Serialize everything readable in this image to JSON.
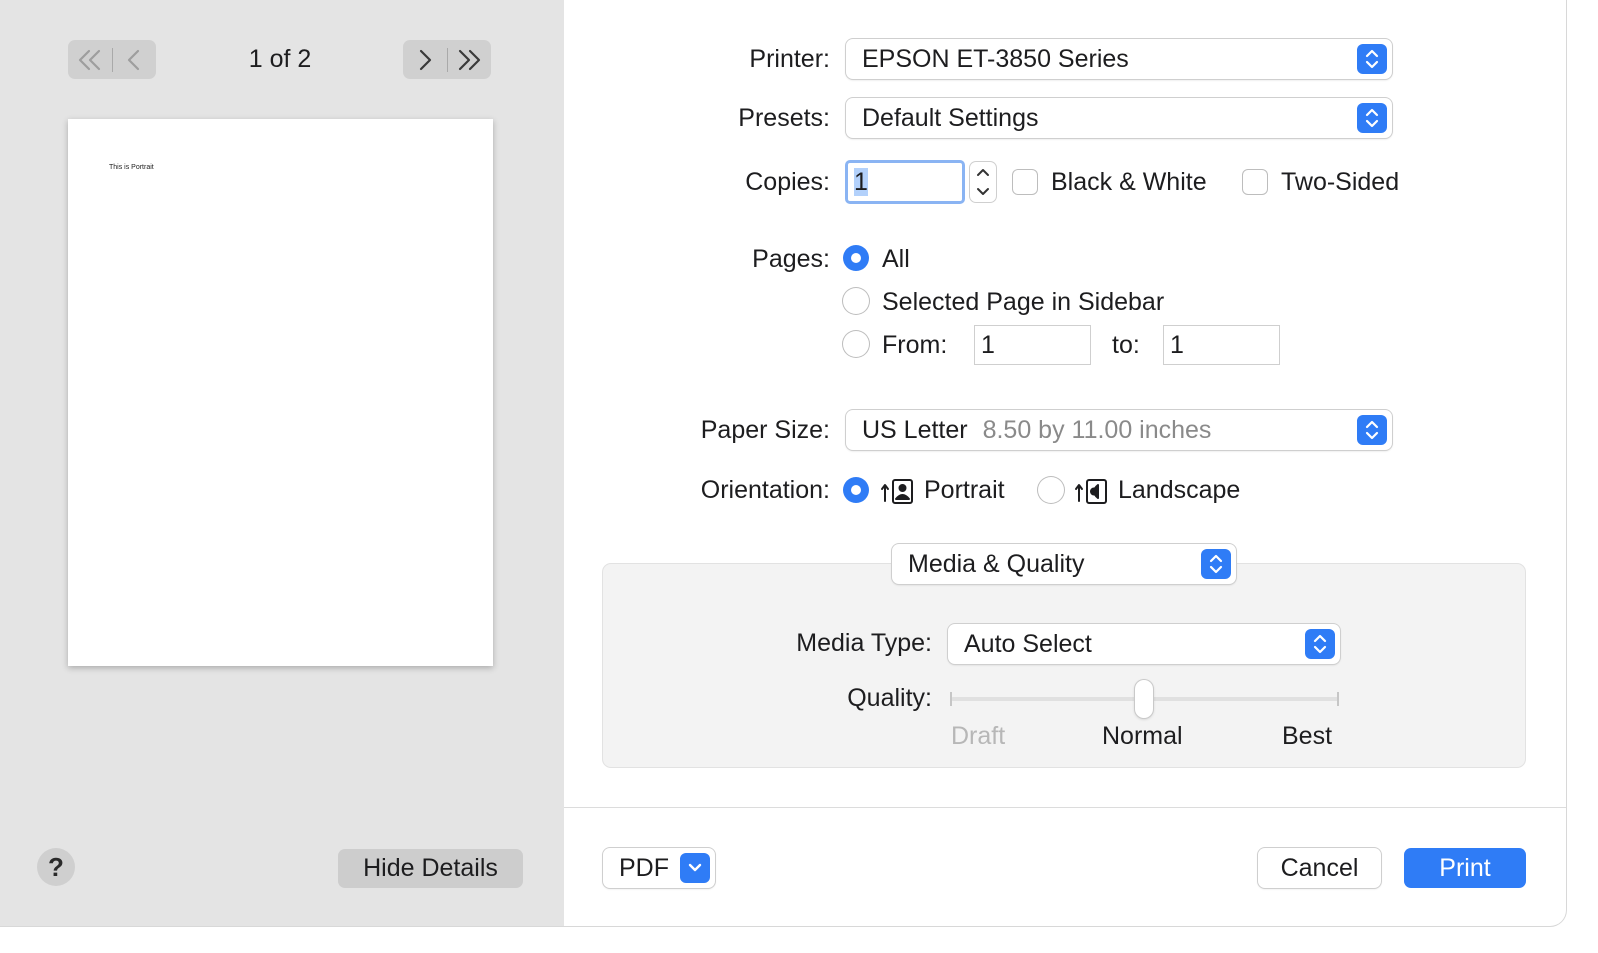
{
  "preview": {
    "page_indicator": "1 of 2",
    "page_text": "This is Portrait",
    "hide_details_label": "Hide Details",
    "help_label": "?"
  },
  "settings": {
    "printer_label": "Printer:",
    "printer_value": "EPSON ET-3850 Series",
    "presets_label": "Presets:",
    "presets_value": "Default Settings",
    "copies_label": "Copies:",
    "copies_value": "1",
    "bw_label": "Black & White",
    "two_sided_label": "Two-Sided",
    "pages_label": "Pages:",
    "pages_all": "All",
    "pages_selected": "Selected Page in Sidebar",
    "pages_from_label": "From:",
    "pages_from_value": "1",
    "pages_to_label": "to:",
    "pages_to_value": "1",
    "paper_size_label": "Paper Size:",
    "paper_size_value": "US Letter",
    "paper_size_detail": "8.50 by 11.00 inches",
    "orientation_label": "Orientation:",
    "orientation_portrait": "Portrait",
    "orientation_landscape": "Landscape",
    "section_value": "Media & Quality",
    "media_type_label": "Media Type:",
    "media_type_value": "Auto Select",
    "quality_label": "Quality:",
    "quality_levels": [
      "Draft",
      "Normal",
      "Best"
    ],
    "quality_selected": "Normal"
  },
  "footer": {
    "pdf_label": "PDF",
    "cancel_label": "Cancel",
    "print_label": "Print"
  },
  "colors": {
    "accent": "#2f7cf6",
    "sidebar_bg": "#e4e4e4"
  }
}
